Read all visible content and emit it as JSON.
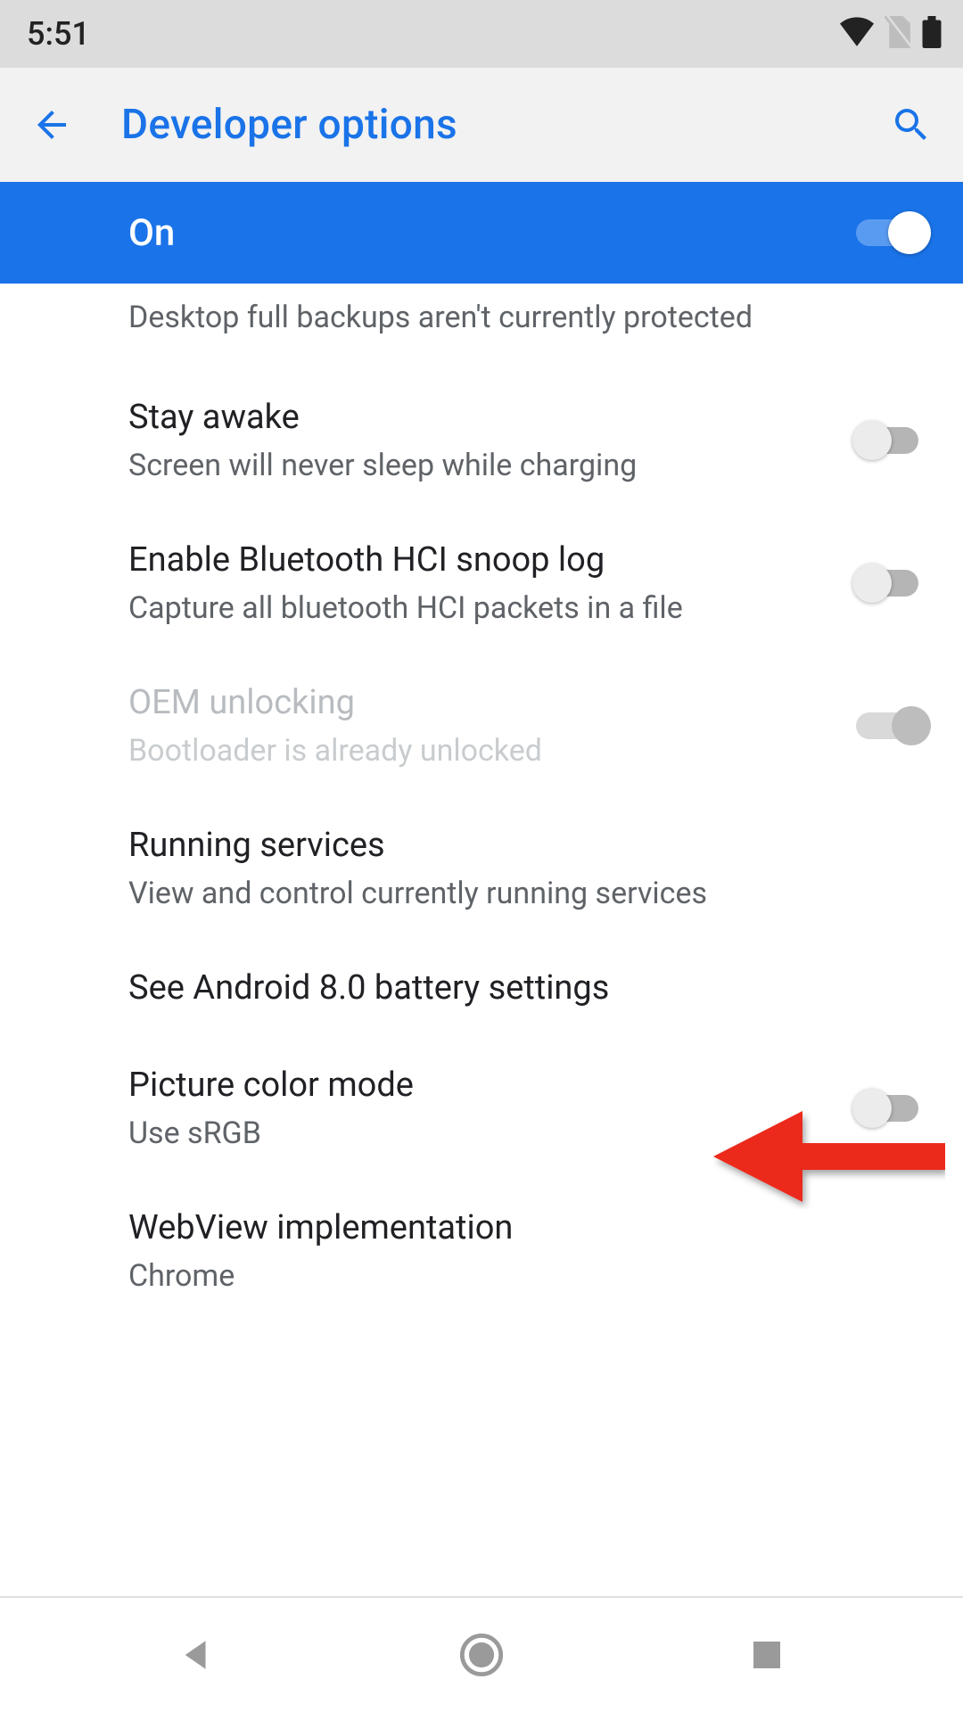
{
  "statusbar": {
    "time": "5:51"
  },
  "appbar": {
    "title": "Developer options"
  },
  "master": {
    "label": "On",
    "on": true
  },
  "cut_line": "Desktop full backups aren't currently protected",
  "items": [
    {
      "title": "Stay awake",
      "subtitle": "Screen will never sleep while charging",
      "toggle": "off"
    },
    {
      "title": "Enable Bluetooth HCI snoop log",
      "subtitle": "Capture all bluetooth HCI packets in a file",
      "toggle": "off"
    },
    {
      "title": "OEM unlocking",
      "subtitle": "Bootloader is already unlocked",
      "toggle": "disabled",
      "disabled": true
    },
    {
      "title": "Running services",
      "subtitle": "View and control currently running services"
    },
    {
      "title": "See Android 8.0 battery settings"
    },
    {
      "title": "Picture color mode",
      "subtitle": "Use sRGB",
      "toggle": "off"
    },
    {
      "title": "WebView implementation",
      "subtitle": "Chrome"
    }
  ],
  "colors": {
    "accent": "#1a73e8",
    "annotation": "#ec2b1e"
  }
}
